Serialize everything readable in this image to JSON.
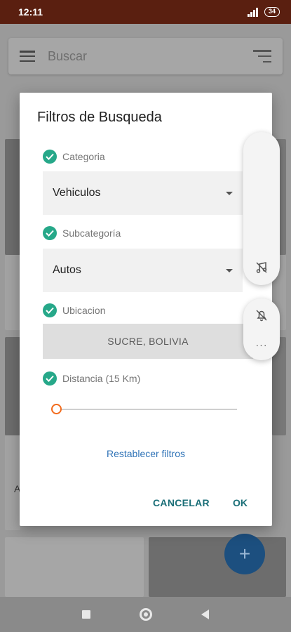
{
  "status_bar": {
    "time": "12:11",
    "battery": "34"
  },
  "search": {
    "placeholder": "Buscar"
  },
  "background_card_text": "A",
  "dialog": {
    "title": "Filtros de Busqueda",
    "fields": [
      {
        "label": "Categoria",
        "value": "Vehiculos"
      },
      {
        "label": "Subcategoría",
        "value": "Autos"
      },
      {
        "label": "Ubicacion",
        "value": "SUCRE, BOLIVIA"
      },
      {
        "label": "Distancia (15 Km)"
      }
    ],
    "distance_slider_fraction": 0.0,
    "reset_link": "Restablecer filtros",
    "cancel_button": "CANCELAR",
    "ok_button": "OK"
  },
  "fab": {
    "label": "+"
  },
  "side_panel": {
    "icons": [
      "music-off-icon",
      "bell-off-icon",
      "more-dots-icon"
    ],
    "more_label": "···"
  },
  "colors": {
    "check": "#26a889",
    "slider_thumb": "#f26a1b",
    "link": "#2f73b7",
    "action": "#1b6f78",
    "status_bar": "#5a1f10"
  }
}
